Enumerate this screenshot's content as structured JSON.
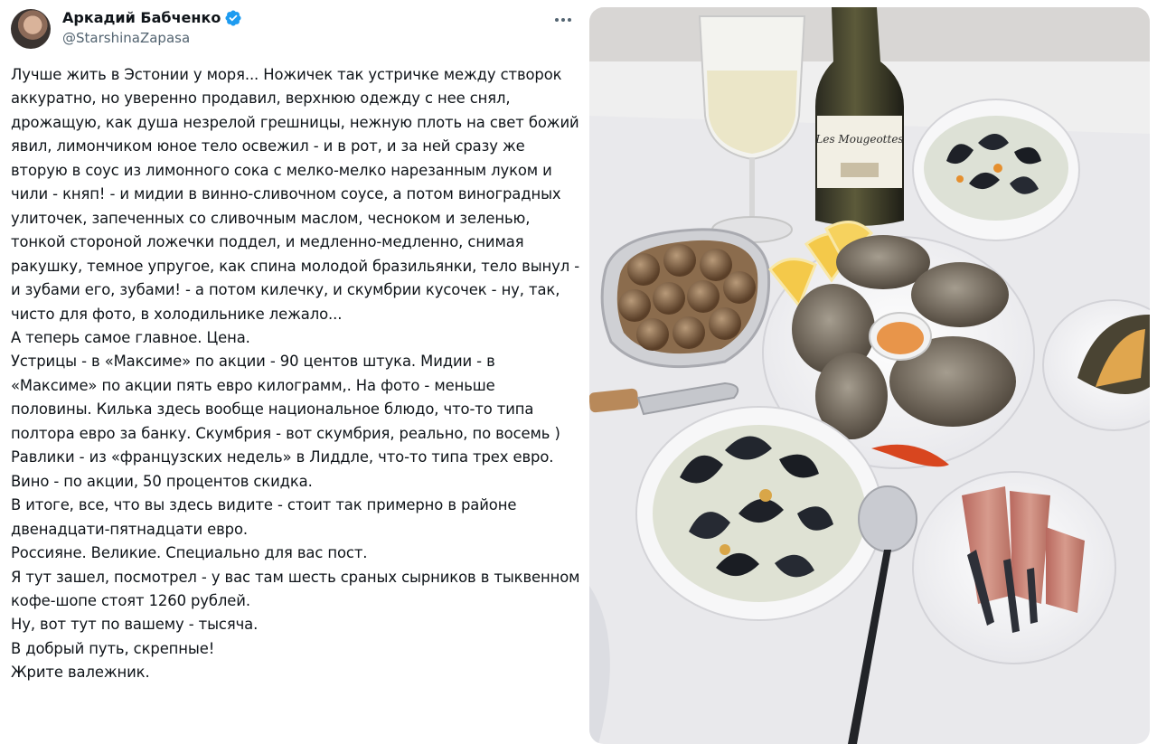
{
  "author": {
    "name": "Аркадий Бабченко",
    "handle": "@StarshinaZapasa",
    "verified": true,
    "avatar_icon": "avatar-photo"
  },
  "actions": {
    "more_icon": "more-horizontal-icon"
  },
  "tweet": {
    "lines": [
      "Лучше жить в Эстонии у моря... Ножичек так устричке между створок",
      "аккуратно, но уверенно продавил, верхнюю одежду с нее снял,",
      "дрожащую, как душа незрелой грешницы, нежную плоть на свет божий",
      "явил, лимончиком юное тело освежил - и в рот, и за ней сразу же",
      "вторую в соус из лимонного сока с мелко-мелко нарезанным луком и",
      "чили - княп! - и мидии в винно-сливочном соусе, а потом виноградных",
      "улиточек, запеченных со сливочным маслом, чесноком и зеленью,",
      "тонкой стороной ложечки поддел, и медленно-медленно, снимая",
      "ракушку, темное упругое, как спина молодой бразильянки, тело вынул -",
      "и зубами его, зубами! - а потом килечку, и скумбрии кусочек - ну, так,",
      "чисто для фото, в холодильнике лежало...",
      "А теперь самое главное. Цена.",
      "Устрицы - в «Максиме» по акции - 90 центов штука. Мидии - в",
      "«Максиме» по акции пять евро килограмм,. На фото - меньше",
      "половины. Килька здесь вообще национальное блюдо, что-то типа",
      "полтора евро за банку. Скумбрия - вот скумбрия, реально, по восемь )",
      "Равлики - из «французских недель» в Лиддле, что-то типа трех евро.",
      "Вино - по акции, 50 процентов скидка.",
      "В итоге, все, что вы здесь видите - стоит так примерно в районе",
      "двенадцати-пятнадцати евро.",
      "Россияне. Великие. Специально для вас пост.",
      "Я тут зашел, посмотрел - у вас там шесть сраных сырников в тыквенном",
      "кофе-шопе стоят 1260 рублей.",
      "Ну, вот тут по вашему - тысяча.",
      "В добрый путь, скрепные!",
      "Жрите валежник."
    ]
  },
  "photo": {
    "description_icon": "food-photo",
    "bottle_label_text": "Les Mougeottes",
    "colors": {
      "table": "#e9e9ec",
      "mussel": "#1e2128",
      "oyster": "#7d7466",
      "lemon": "#f4c94a",
      "fish": "#c98679"
    }
  },
  "theme": {
    "verified_color": "#1d9bf0",
    "text_color": "#0f1419",
    "secondary_text": "#536471"
  }
}
